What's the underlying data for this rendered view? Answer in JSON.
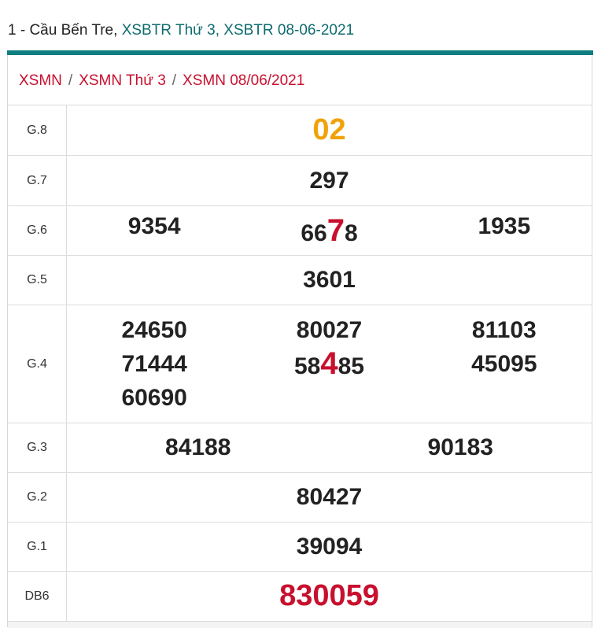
{
  "header": {
    "prefix": "1 - Cầu Bến Tre,",
    "link1": "XSBTR Thứ 3,",
    "link2": "XSBTR 08-06-2021"
  },
  "breadcrumb": {
    "items": [
      "XSMN",
      "XSMN Thứ 3",
      "XSMN 08/06/2021"
    ],
    "separator": "/"
  },
  "results": {
    "g8": {
      "label": "G.8",
      "value": "02"
    },
    "g7": {
      "label": "G.7",
      "value": "297"
    },
    "g6": {
      "label": "G.6",
      "v1": "9354",
      "v2_pre": "66",
      "v2_hl": "7",
      "v2_post": "8",
      "v3": "1935"
    },
    "g5": {
      "label": "G.5",
      "value": "3601"
    },
    "g4": {
      "label": "G.4",
      "col1": [
        "24650",
        "71444",
        "60690"
      ],
      "col2_a": "80027",
      "col2_b_pre": "58",
      "col2_b_hl": "4",
      "col2_b_post": "85",
      "col3": [
        "81103",
        "45095"
      ]
    },
    "g3": {
      "label": "G.3",
      "v1": "84188",
      "v2": "90183"
    },
    "g2": {
      "label": "G.2",
      "value": "80427"
    },
    "g1": {
      "label": "G.1",
      "value": "39094"
    },
    "db": {
      "label": "DB6",
      "value": "830059"
    }
  },
  "colors": {
    "accent": "#0f7e80",
    "highlight": "#c8102e",
    "g8": "#f0a20b"
  }
}
